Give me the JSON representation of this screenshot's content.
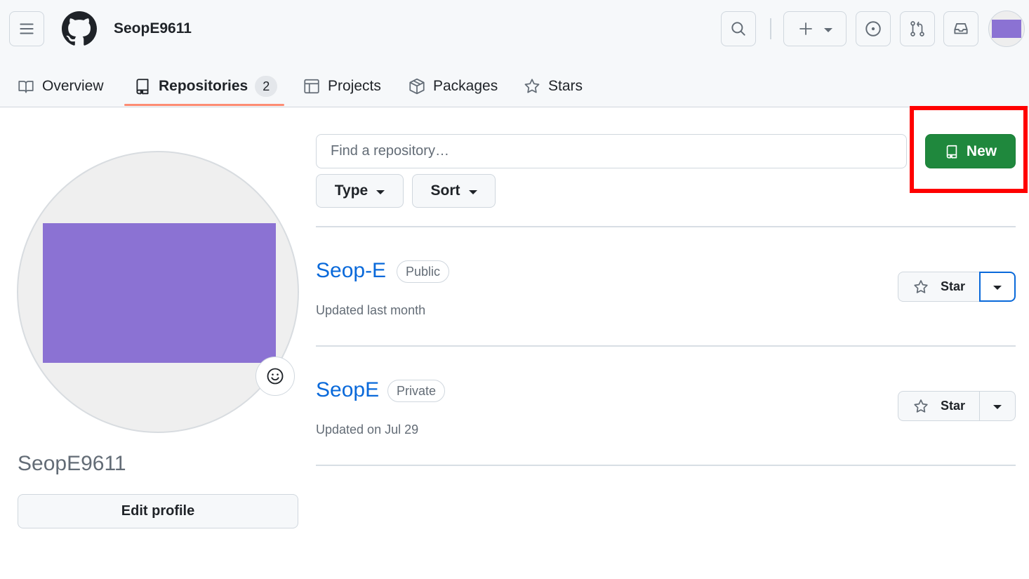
{
  "header": {
    "username": "SeopE9611"
  },
  "tabs": [
    {
      "label": "Overview"
    },
    {
      "label": "Repositories",
      "count": "2",
      "selected": true
    },
    {
      "label": "Projects"
    },
    {
      "label": "Packages"
    },
    {
      "label": "Stars"
    }
  ],
  "profile": {
    "name": "SeopE9611",
    "edit_label": "Edit profile"
  },
  "filters": {
    "find_placeholder": "Find a repository…",
    "type_label": "Type",
    "sort_label": "Sort",
    "new_label": "New"
  },
  "repos": [
    {
      "name": "Seop-E",
      "visibility": "Public",
      "updated": "Updated last month",
      "star_label": "Star"
    },
    {
      "name": "SeopE",
      "visibility": "Private",
      "updated": "Updated on Jul 29",
      "star_label": "Star"
    }
  ],
  "colors": {
    "accent": "#0969da",
    "primary_button": "#1f883d",
    "tab_underline": "#fd8c73",
    "highlight": "#ff0000",
    "avatar": "#8b72d3"
  }
}
